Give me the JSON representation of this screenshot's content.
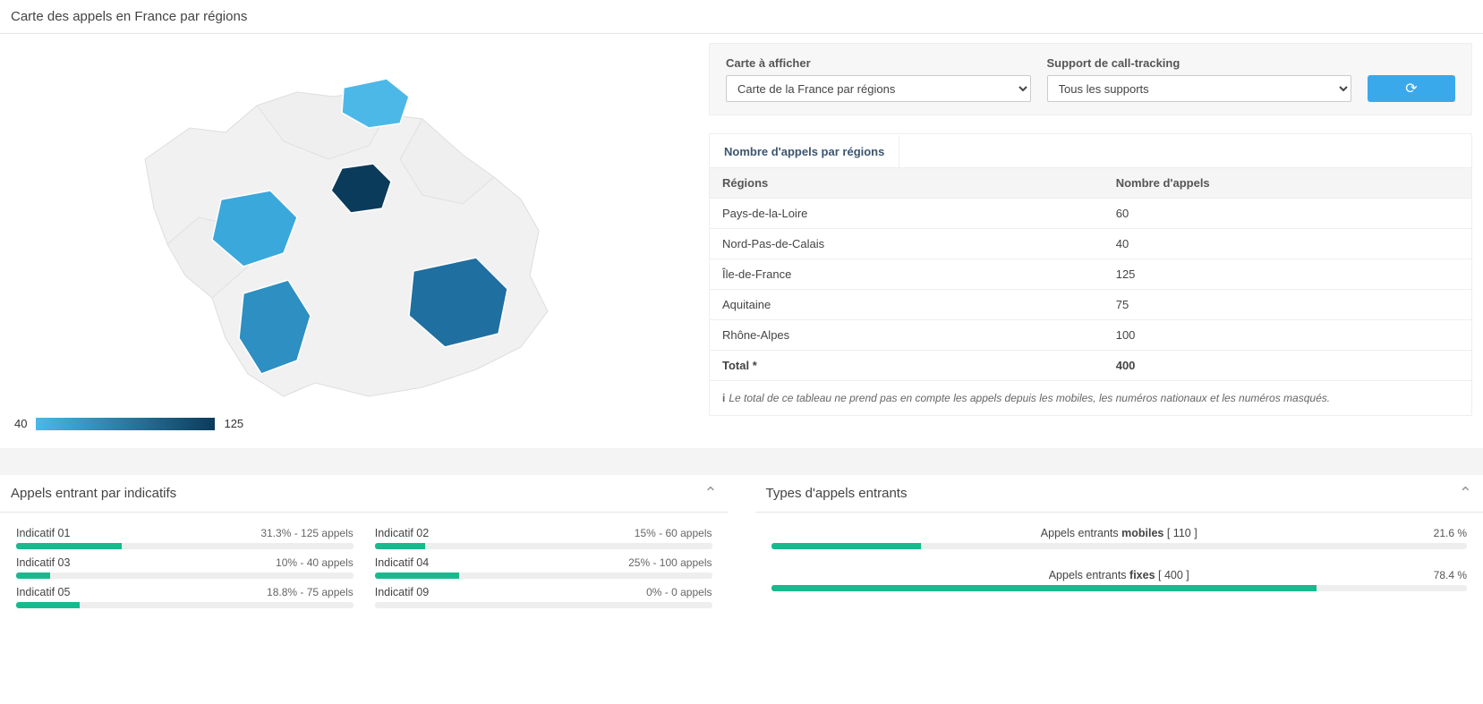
{
  "header": {
    "title": "Carte des appels en France par régions"
  },
  "controls": {
    "map_label": "Carte à afficher",
    "map_selected": "Carte de la France par régions",
    "support_label": "Support de call-tracking",
    "support_selected": "Tous les supports"
  },
  "tab": {
    "label": "Nombre d'appels par régions"
  },
  "table": {
    "col_region": "Régions",
    "col_calls": "Nombre d'appels",
    "rows": [
      {
        "region": "Pays-de-la-Loire",
        "calls": "60"
      },
      {
        "region": "Nord-Pas-de-Calais",
        "calls": "40"
      },
      {
        "region": "Île-de-France",
        "calls": "125"
      },
      {
        "region": "Aquitaine",
        "calls": "75"
      },
      {
        "region": "Rhône-Alpes",
        "calls": "100"
      }
    ],
    "total_label": "Total *",
    "total_value": "400"
  },
  "footnote": {
    "prefix": "i",
    "text": "Le total de ce tableau ne prend pas en compte les appels depuis les mobiles, les numéros nationaux et les numéros masqués."
  },
  "legend": {
    "min": "40",
    "max": "125"
  },
  "indicatifs_panel": {
    "title": "Appels entrant par indicatifs"
  },
  "indicatifs": [
    {
      "name": "Indicatif 01",
      "detail": "31.3% - 125 appels",
      "pct": 31.3
    },
    {
      "name": "Indicatif 02",
      "detail": "15% - 60 appels",
      "pct": 15
    },
    {
      "name": "Indicatif 03",
      "detail": "10% - 40 appels",
      "pct": 10
    },
    {
      "name": "Indicatif 04",
      "detail": "25% - 100 appels",
      "pct": 25
    },
    {
      "name": "Indicatif 05",
      "detail": "18.8% - 75 appels",
      "pct": 18.8
    },
    {
      "name": "Indicatif 09",
      "detail": "0% - 0 appels",
      "pct": 0
    }
  ],
  "types_panel": {
    "title": "Types d'appels entrants"
  },
  "types": {
    "mobiles": {
      "prefix": "Appels entrants ",
      "bold": "mobiles",
      "count": " [ 110 ]",
      "pct": "21.6 %",
      "width": 21.6
    },
    "fixes": {
      "prefix": "Appels entrants ",
      "bold": "fixes",
      "count": " [ 400 ]",
      "pct": "78.4 %",
      "width": 78.4
    }
  },
  "chart_data": {
    "type": "map",
    "title": "Carte des appels en France par régions",
    "value_label": "Nombre d'appels",
    "color_scale": {
      "min_color": "#4cb8e8",
      "max_color": "#0b3b5a",
      "min_value": 40,
      "max_value": 125
    },
    "regions": [
      {
        "name": "Pays-de-la-Loire",
        "value": 60
      },
      {
        "name": "Nord-Pas-de-Calais",
        "value": 40
      },
      {
        "name": "Île-de-France",
        "value": 125
      },
      {
        "name": "Aquitaine",
        "value": 75
      },
      {
        "name": "Rhône-Alpes",
        "value": 100
      }
    ]
  }
}
